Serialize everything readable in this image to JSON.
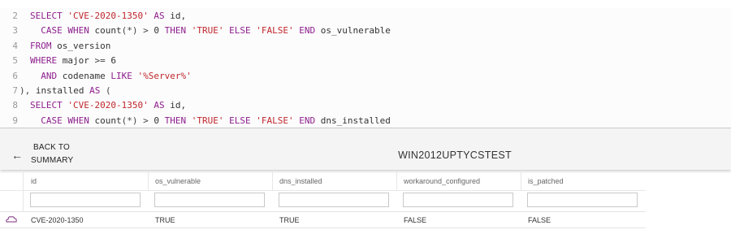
{
  "editor": {
    "lines": [
      {
        "num": "2",
        "tokens": [
          [
            "kw",
            "SELECT "
          ],
          [
            "str",
            "'CVE-2020-1350'"
          ],
          [
            "kw",
            " AS "
          ],
          [
            "id",
            "id,"
          ]
        ]
      },
      {
        "num": "3",
        "tokens": [
          [
            "kw",
            "  CASE WHEN "
          ],
          [
            "id",
            "count"
          ],
          [
            "op",
            "(*) > "
          ],
          [
            "num",
            "0"
          ],
          [
            "kw",
            " THEN "
          ],
          [
            "str",
            "'TRUE'"
          ],
          [
            "kw",
            " ELSE "
          ],
          [
            "str",
            "'FALSE'"
          ],
          [
            "kw",
            " END "
          ],
          [
            "id",
            "os_vulnerable"
          ]
        ]
      },
      {
        "num": "4",
        "tokens": [
          [
            "kw",
            "FROM "
          ],
          [
            "id",
            "os_version"
          ]
        ]
      },
      {
        "num": "5",
        "tokens": [
          [
            "kw",
            "WHERE "
          ],
          [
            "id",
            "major "
          ],
          [
            "op",
            ">= "
          ],
          [
            "num",
            "6"
          ]
        ]
      },
      {
        "num": "6",
        "tokens": [
          [
            "kw",
            "  AND "
          ],
          [
            "id",
            "codename "
          ],
          [
            "kw",
            "LIKE "
          ],
          [
            "str",
            "'%Server%'"
          ]
        ]
      },
      {
        "num": "7",
        "tokens": [
          [
            "op",
            "), "
          ],
          [
            "id",
            "installed "
          ],
          [
            "kw",
            "AS "
          ],
          [
            "op",
            "("
          ]
        ],
        "outdent": true
      },
      {
        "num": "8",
        "tokens": [
          [
            "kw",
            "SELECT "
          ],
          [
            "str",
            "'CVE-2020-1350'"
          ],
          [
            "kw",
            " AS "
          ],
          [
            "id",
            "id,"
          ]
        ]
      },
      {
        "num": "9",
        "tokens": [
          [
            "kw",
            "  CASE WHEN "
          ],
          [
            "id",
            "count"
          ],
          [
            "op",
            "(*) > "
          ],
          [
            "num",
            "0"
          ],
          [
            "kw",
            " THEN "
          ],
          [
            "str",
            "'TRUE'"
          ],
          [
            "kw",
            " ELSE "
          ],
          [
            "str",
            "'FALSE'"
          ],
          [
            "kw",
            " END "
          ],
          [
            "id",
            "dns_installed"
          ]
        ]
      }
    ]
  },
  "header": {
    "back_line1": "BACK TO",
    "back_line2": "SUMMARY",
    "back_icon": "arrow-left-icon",
    "title": "WIN2012UPTYCSTEST"
  },
  "table": {
    "columns": [
      "id",
      "os_vulnerable",
      "dns_installed",
      "workaround_configured",
      "is_patched"
    ],
    "filters": [
      "",
      "",
      "",
      "",
      ""
    ],
    "rows": [
      {
        "icon": "cloud-outline-icon",
        "cells": [
          "CVE-2020-1350",
          "TRUE",
          "TRUE",
          "FALSE",
          "FALSE"
        ]
      }
    ]
  }
}
